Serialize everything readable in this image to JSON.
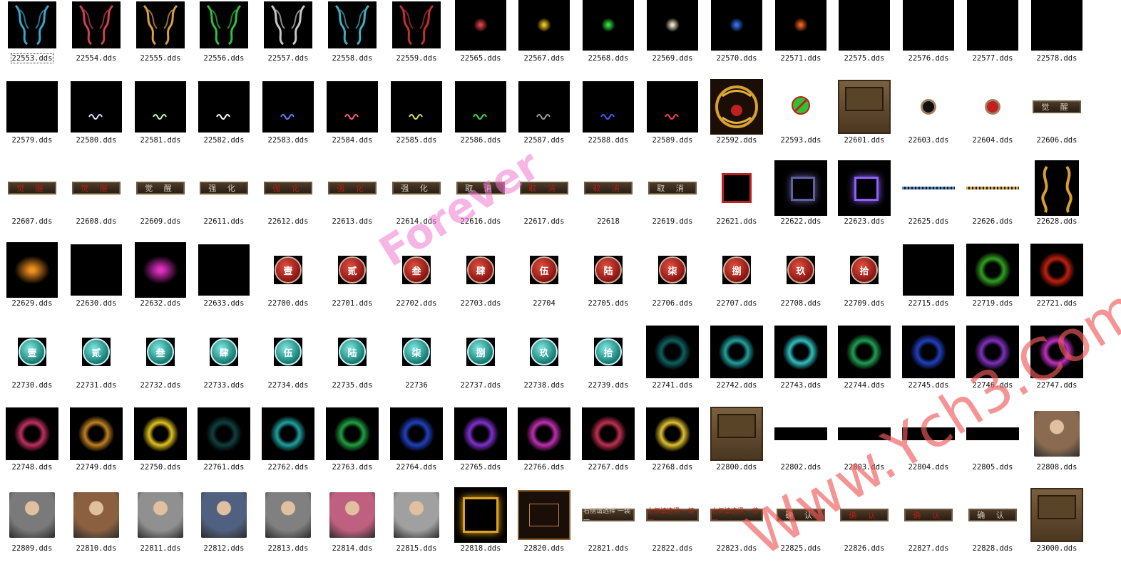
{
  "watermarks": {
    "primary": "Forever",
    "secondary": "Www.Ych3.Com"
  },
  "files": [
    {
      "name": "22553.dds",
      "kind": "wing",
      "color": "#3aa8c8",
      "selected": true
    },
    {
      "name": "22554.dds",
      "kind": "wing",
      "color": "#d04050"
    },
    {
      "name": "22555.dds",
      "kind": "wing",
      "color": "#d8a040"
    },
    {
      "name": "22556.dds",
      "kind": "wing",
      "color": "#30c040"
    },
    {
      "name": "22557.dds",
      "kind": "wing",
      "color": "#c8c8c8"
    },
    {
      "name": "22558.dds",
      "kind": "wing",
      "color": "#40b0c0"
    },
    {
      "name": "22559.dds",
      "kind": "wing",
      "color": "#c03030"
    },
    {
      "name": "22565.dds",
      "kind": "glow",
      "color": "#e04040"
    },
    {
      "name": "22567.dds",
      "kind": "glow",
      "color": "#f0c020"
    },
    {
      "name": "22568.dds",
      "kind": "glow",
      "color": "#30e040"
    },
    {
      "name": "22569.dds",
      "kind": "glow",
      "color": "#e8e0c0"
    },
    {
      "name": "22570.dds",
      "kind": "glow",
      "color": "#3070f0"
    },
    {
      "name": "22571.dds",
      "kind": "glow",
      "color": "#f06020"
    },
    {
      "name": "22575.dds",
      "kind": "dark"
    },
    {
      "name": "22576.dds",
      "kind": "dark"
    },
    {
      "name": "22577.dds",
      "kind": "dark"
    },
    {
      "name": "22578.dds",
      "kind": "dark"
    },
    {
      "name": "22579.dds",
      "kind": "dark"
    },
    {
      "name": "22580.dds",
      "kind": "squiggle",
      "color": "#e0e0ff"
    },
    {
      "name": "22581.dds",
      "kind": "squiggle",
      "color": "#c0ffc0"
    },
    {
      "name": "22582.dds",
      "kind": "squiggle",
      "color": "#ffffff"
    },
    {
      "name": "22583.dds",
      "kind": "squiggle",
      "color": "#6080ff"
    },
    {
      "name": "22584.dds",
      "kind": "squiggle",
      "color": "#ff6080"
    },
    {
      "name": "22585.dds",
      "kind": "squiggle",
      "color": "#e0e060"
    },
    {
      "name": "22586.dds",
      "kind": "squiggle",
      "color": "#40e040"
    },
    {
      "name": "22587.dds",
      "kind": "squiggle",
      "color": "#a0a0a0"
    },
    {
      "name": "22588.dds",
      "kind": "squiggle",
      "color": "#4060ff"
    },
    {
      "name": "22589.dds",
      "kind": "squiggle",
      "color": "#ff4040"
    },
    {
      "name": "22592.dds",
      "kind": "emblem"
    },
    {
      "name": "22593.dds",
      "kind": "nosign"
    },
    {
      "name": "22601.dds",
      "kind": "panel"
    },
    {
      "name": "22603.dds",
      "kind": "dot",
      "color": "#101010"
    },
    {
      "name": "22604.dds",
      "kind": "dot",
      "color": "#c02020"
    },
    {
      "name": "22606.dds",
      "kind": "btn",
      "text": "觉 醒"
    },
    {
      "name": "22607.dds",
      "kind": "btn",
      "text": "觉 醒",
      "red": true
    },
    {
      "name": "22608.dds",
      "kind": "btn",
      "text": "觉 醒",
      "red": true
    },
    {
      "name": "22609.dds",
      "kind": "btn",
      "text": "觉 醒"
    },
    {
      "name": "22611.dds",
      "kind": "btn",
      "text": "强 化"
    },
    {
      "name": "22612.dds",
      "kind": "btn",
      "text": "强 化",
      "red": true
    },
    {
      "name": "22613.dds",
      "kind": "btn",
      "text": "强 化",
      "red": true
    },
    {
      "name": "22614.dds",
      "kind": "btn",
      "text": "强 化"
    },
    {
      "name": "22616.dds",
      "kind": "btn",
      "text": "取 消"
    },
    {
      "name": "22617.dds",
      "kind": "btn",
      "text": "取 消",
      "red": true
    },
    {
      "name": "22618",
      "kind": "btn",
      "text": "取 消",
      "red": true
    },
    {
      "name": "22619.dds",
      "kind": "btn",
      "text": "取 消"
    },
    {
      "name": "22621.dds",
      "kind": "redframe"
    },
    {
      "name": "22622.dds",
      "kind": "sqframe",
      "color": "#6060a0"
    },
    {
      "name": "22623.dds",
      "kind": "sqframe",
      "color": "#9060ff"
    },
    {
      "name": "22625.dds",
      "kind": "bar",
      "color": "#4880c0"
    },
    {
      "name": "22626.dds",
      "kind": "bar",
      "color": "#d0a030"
    },
    {
      "name": "22628.dds",
      "kind": "dragon"
    },
    {
      "name": "22629.dds",
      "kind": "flare",
      "color": "#f09020"
    },
    {
      "name": "22630.dds",
      "kind": "dark"
    },
    {
      "name": "22632.dds",
      "kind": "flare",
      "color": "#e030c0"
    },
    {
      "name": "22633.dds",
      "kind": "dark"
    },
    {
      "name": "22700.dds",
      "kind": "coin",
      "text": "壹",
      "red": true
    },
    {
      "name": "22701.dds",
      "kind": "coin",
      "text": "贰",
      "red": true
    },
    {
      "name": "22702.dds",
      "kind": "coin",
      "text": "叁",
      "red": true
    },
    {
      "name": "22703.dds",
      "kind": "coin",
      "text": "肆",
      "red": true
    },
    {
      "name": "22704",
      "kind": "coin",
      "text": "伍",
      "red": true
    },
    {
      "name": "22705.dds",
      "kind": "coin",
      "text": "陆",
      "red": true
    },
    {
      "name": "22706.dds",
      "kind": "coin",
      "text": "柒",
      "red": true
    },
    {
      "name": "22707.dds",
      "kind": "coin",
      "text": "捌",
      "red": true
    },
    {
      "name": "22708.dds",
      "kind": "coin",
      "text": "玖",
      "red": true
    },
    {
      "name": "22709.dds",
      "kind": "coin",
      "text": "拾",
      "red": true
    },
    {
      "name": "22715.dds",
      "kind": "dark"
    },
    {
      "name": "22719.dds",
      "kind": "ring",
      "color": "#30a020"
    },
    {
      "name": "22721.dds",
      "kind": "ring",
      "color": "#c02010"
    },
    {
      "name": "22730.dds",
      "kind": "coin",
      "text": "壹"
    },
    {
      "name": "22731.dds",
      "kind": "coin",
      "text": "贰"
    },
    {
      "name": "22732.dds",
      "kind": "coin",
      "text": "叁"
    },
    {
      "name": "22733.dds",
      "kind": "coin",
      "text": "肆"
    },
    {
      "name": "22734.dds",
      "kind": "coin",
      "text": "伍"
    },
    {
      "name": "22735.dds",
      "kind": "coin",
      "text": "陆"
    },
    {
      "name": "22736",
      "kind": "coin",
      "text": "柒"
    },
    {
      "name": "22737.dds",
      "kind": "coin",
      "text": "捌"
    },
    {
      "name": "22738.dds",
      "kind": "coin",
      "text": "玖"
    },
    {
      "name": "22739.dds",
      "kind": "coin",
      "text": "拾"
    },
    {
      "name": "22741.dds",
      "kind": "ring",
      "color": "#106060"
    },
    {
      "name": "22742.dds",
      "kind": "ring",
      "color": "#20a0a0"
    },
    {
      "name": "22743.dds",
      "kind": "ring",
      "color": "#30c0c0"
    },
    {
      "name": "22744.dds",
      "kind": "ring",
      "color": "#20a050"
    },
    {
      "name": "22745.dds",
      "kind": "ring",
      "color": "#2040c0"
    },
    {
      "name": "22746.dds",
      "kind": "ring",
      "color": "#8030c0"
    },
    {
      "name": "22747.dds",
      "kind": "ring",
      "color": "#c030c0"
    },
    {
      "name": "22748.dds",
      "kind": "ring",
      "color": "#c03060"
    },
    {
      "name": "22749.dds",
      "kind": "ring",
      "color": "#c08020"
    },
    {
      "name": "22750.dds",
      "kind": "ring",
      "color": "#e0c020"
    },
    {
      "name": "22761.dds",
      "kind": "ring",
      "color": "#104040"
    },
    {
      "name": "22762.dds",
      "kind": "ring",
      "color": "#20a0a0"
    },
    {
      "name": "22763.dds",
      "kind": "ring",
      "color": "#20a040"
    },
    {
      "name": "22764.dds",
      "kind": "ring",
      "color": "#2040c0"
    },
    {
      "name": "22765.dds",
      "kind": "ring",
      "color": "#8030d0"
    },
    {
      "name": "22766.dds",
      "kind": "ring",
      "color": "#c030b0"
    },
    {
      "name": "22767.dds",
      "kind": "ring",
      "color": "#c03050"
    },
    {
      "name": "22768.dds",
      "kind": "ring",
      "color": "#e0c030"
    },
    {
      "name": "22800.dds",
      "kind": "panel"
    },
    {
      "name": "22802.dds",
      "kind": "blackbar"
    },
    {
      "name": "22803.dds",
      "kind": "blackbar"
    },
    {
      "name": "22804.dds",
      "kind": "blackbar"
    },
    {
      "name": "22805.dds",
      "kind": "blackbar"
    },
    {
      "name": "22808.dds",
      "kind": "portrait",
      "color": "#8a6a50"
    },
    {
      "name": "22809.dds",
      "kind": "portrait",
      "color": "#7a7a7a"
    },
    {
      "name": "22810.dds",
      "kind": "portrait",
      "color": "#8a6040"
    },
    {
      "name": "22811.dds",
      "kind": "portrait",
      "color": "#909090"
    },
    {
      "name": "22812.dds",
      "kind": "portrait",
      "color": "#506080"
    },
    {
      "name": "22813.dds",
      "kind": "portrait",
      "color": "#808080"
    },
    {
      "name": "22814.dds",
      "kind": "portrait",
      "color": "#c06080"
    },
    {
      "name": "22815.dds",
      "kind": "portrait",
      "color": "#a0a0a0"
    },
    {
      "name": "22818.dds",
      "kind": "goldframe"
    },
    {
      "name": "22820.dds",
      "kind": "dialog"
    },
    {
      "name": "22821.dds",
      "kind": "btn",
      "text": "右侧请选择 一装一"
    },
    {
      "name": "22822.dds",
      "kind": "btn",
      "text": "右侧请选择 一装一",
      "red": true
    },
    {
      "name": "22823.dds",
      "kind": "btn",
      "text": "右侧请选择 一装一",
      "red": true
    },
    {
      "name": "22825.dds",
      "kind": "btn",
      "text": "确 认"
    },
    {
      "name": "22826.dds",
      "kind": "btn",
      "text": "确 认",
      "red": true
    },
    {
      "name": "22827.dds",
      "kind": "btn",
      "text": "确 认",
      "red": true
    },
    {
      "name": "22828.dds",
      "kind": "btn",
      "text": "确 认"
    },
    {
      "name": "23000.dds",
      "kind": "panel"
    }
  ]
}
